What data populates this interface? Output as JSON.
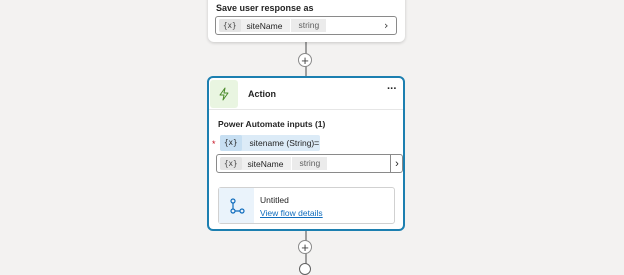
{
  "save_response": {
    "label": "Save user response as",
    "variable": {
      "icon": "variable-icon",
      "icon_text": "{x}",
      "name": "siteName",
      "type": "string"
    }
  },
  "action": {
    "title": "Action",
    "more_label": "···",
    "inputs_title": "Power Automate inputs (1)",
    "required_mark": "*",
    "param": {
      "icon_text": "{x}",
      "name": "sitename (String)"
    },
    "equals": "=",
    "value_variable": {
      "icon_text": "{x}",
      "name": "siteName",
      "type": "string"
    },
    "flow": {
      "name": "Untitled",
      "link": "View flow details"
    }
  },
  "canvas": {
    "add_label": "+"
  },
  "colors": {
    "selected_border": "#1c7fb0",
    "link": "#0f6cbd",
    "required": "#c50f1f"
  }
}
